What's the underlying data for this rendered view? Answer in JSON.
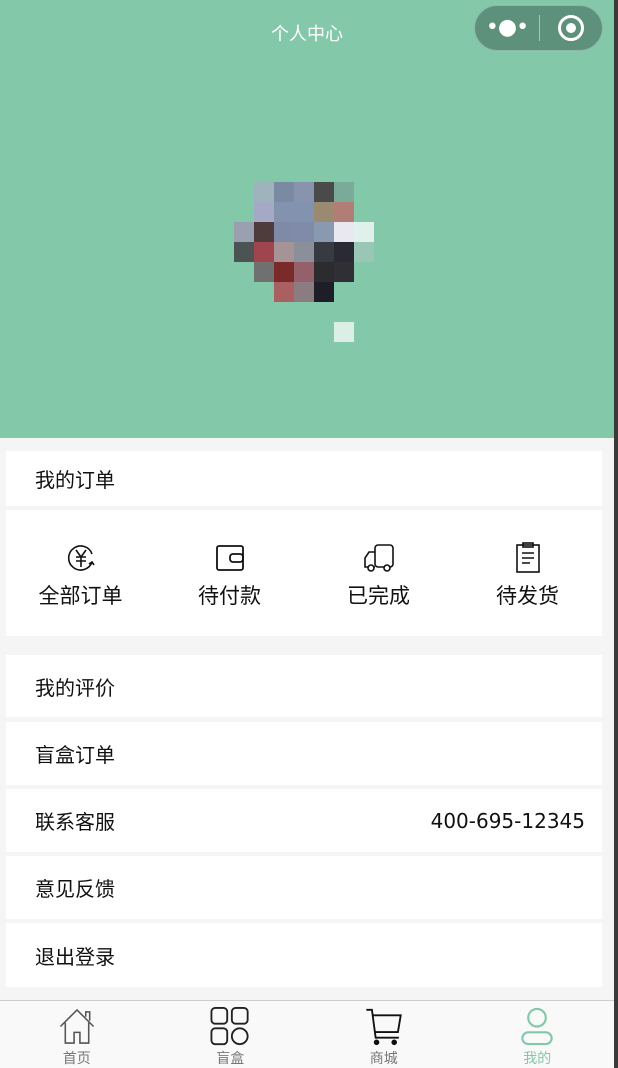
{
  "header": {
    "title": "个人中心",
    "bg": "#82c8a9"
  },
  "orders": {
    "title": "我的订单",
    "items": [
      {
        "label": "全部订单",
        "icon": "yuan-refresh-icon"
      },
      {
        "label": "待付款",
        "icon": "wallet-icon"
      },
      {
        "label": "已完成",
        "icon": "truck-icon"
      },
      {
        "label": "待发货",
        "icon": "clipboard-icon"
      }
    ]
  },
  "menu": [
    {
      "label": "我的评价"
    },
    {
      "label": "盲盒订单"
    },
    {
      "label": "联系客服",
      "value": "400-695-12345"
    },
    {
      "label": "意见反馈"
    },
    {
      "label": "退出登录"
    }
  ],
  "tabbar": {
    "active_color": "#82c8a9",
    "items": [
      {
        "label": "首页",
        "icon": "home-icon"
      },
      {
        "label": "盲盒",
        "icon": "grid-icon"
      },
      {
        "label": "商城",
        "icon": "cart-icon"
      },
      {
        "label": "我的",
        "icon": "user-icon"
      }
    ]
  }
}
